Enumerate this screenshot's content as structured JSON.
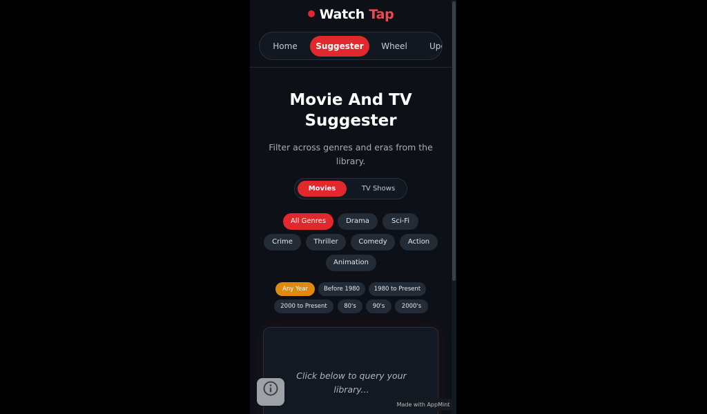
{
  "brand": {
    "word1": "Watch",
    "word2": "Tap"
  },
  "nav": {
    "items": [
      {
        "label": "Home",
        "active": false
      },
      {
        "label": "Suggester",
        "active": true
      },
      {
        "label": "Wheel",
        "active": false
      },
      {
        "label": "Upc",
        "active": false
      }
    ]
  },
  "hero": {
    "title_line1": "Movie And TV",
    "title_line2": "Suggester",
    "subtitle": "Filter across genres and eras from the library."
  },
  "media_toggle": {
    "movies": "Movies",
    "tv_shows": "TV Shows",
    "selected": "Movies"
  },
  "genres": [
    "All Genres",
    "Drama",
    "Sci-Fi",
    "Crime",
    "Thriller",
    "Comedy",
    "Action",
    "Animation"
  ],
  "genre_selected": "All Genres",
  "eras": [
    "Any Year",
    "Before 1980",
    "1980 to Present",
    "2000 to Present",
    "80's",
    "90's",
    "2000's"
  ],
  "era_selected": "Any Year",
  "result_card": {
    "placeholder": "Click below to query your library..."
  },
  "footer": {
    "made_with": "Made with AppMint"
  },
  "colors": {
    "accent": "#e0282d",
    "year_accent": "#e0890f",
    "background": "#0d1117"
  },
  "icons": {
    "info_button": "info-icon"
  }
}
